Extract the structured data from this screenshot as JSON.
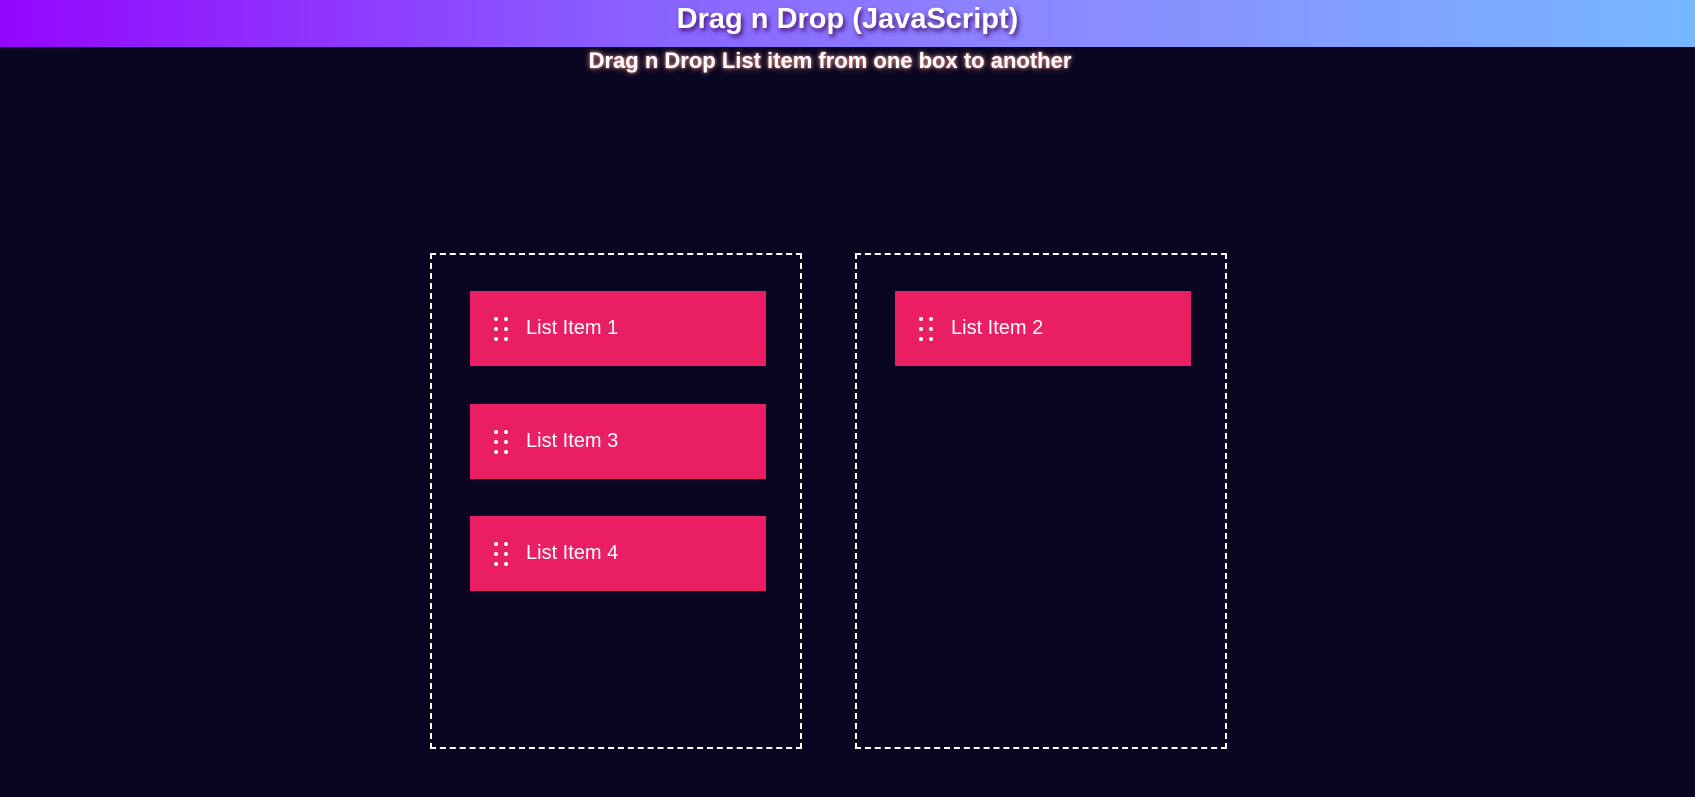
{
  "header": {
    "title": "Drag n Drop (JavaScript)"
  },
  "subtitle": "Drag n Drop List item from one box to another",
  "boxes": [
    {
      "items": [
        {
          "label": "List Item 1"
        },
        {
          "label": "List Item 3"
        },
        {
          "label": "List Item 4"
        }
      ]
    },
    {
      "items": [
        {
          "label": "List Item 2"
        }
      ]
    }
  ],
  "colors": {
    "background": "#0a0622",
    "item": "#e91e63",
    "gradient_start": "#9406fe",
    "gradient_end": "#76b8ff"
  },
  "icons": {
    "drag_handle": "drag-handle-icon"
  }
}
